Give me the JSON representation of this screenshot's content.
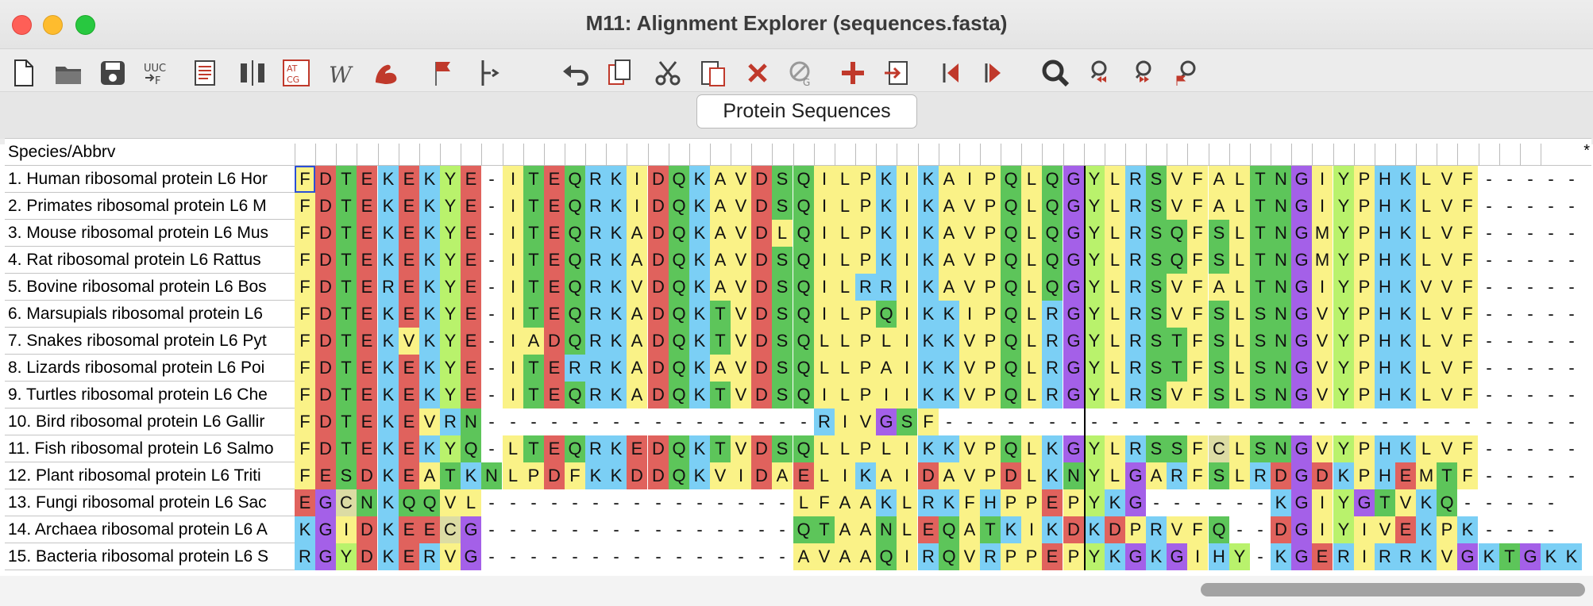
{
  "window": {
    "title": "M11: Alignment Explorer (sequences.fasta)"
  },
  "toolbar": {
    "icons": [
      "new-file-icon",
      "open-folder-icon",
      "save-icon",
      "translate-icon",
      "document-icon",
      "column-icon",
      "nucleotide-icon",
      "wordpad-icon",
      "muscle-icon",
      "flag-icon",
      "branch-icon",
      "undo-icon",
      "copy-icon",
      "cut-icon",
      "paste-icon",
      "delete-icon",
      "delete-gap-icon",
      "add-icon",
      "import-icon",
      "move-left-icon",
      "move-right-icon",
      "search-icon",
      "search-prev-icon",
      "search-next-icon",
      "search-flag-icon"
    ]
  },
  "tab": {
    "label": "Protein Sequences"
  },
  "table": {
    "header": "Species/Abbrv",
    "star": "*",
    "rows": [
      {
        "name": "1. Human ribosomal protein L6 Hor",
        "seq": "FDTEKEKYE-ITEQRKIDQKAVDSQILPKIKAIPQLQGYLRSVFALTNGIYPHKLVF-----"
      },
      {
        "name": "2. Primates ribosomal protein L6 M",
        "seq": "FDTEKEKYE-ITEQRKIDQKAVDSQILPKIKAVPQLQGYLRSVFALTNGIYPHKLVF-----"
      },
      {
        "name": "3. Mouse ribosomal protein L6 Mus",
        "seq": "FDTEKEKYE-ITEQRKADQKAVDLQILPKIKAVPQLQGYLRSQFSLTNGMYPHKLVF-----"
      },
      {
        "name": "4. Rat ribosomal protein L6 Rattus",
        "seq": "FDTEKEKYE-ITEQRKADQKAVDSQILPKIKAVPQLQGYLRSQFSLTNGMYPHKLVF-----"
      },
      {
        "name": "5. Bovine ribosomal protein L6 Bos",
        "seq": "FDTEREKYE-ITEQRKVDQKAVDSQILRRIKAVPQLQGYLRSVFALTNGIYPHKVVF-----"
      },
      {
        "name": "6. Marsupials ribosomal protein L6",
        "seq": "FDTEKEKYE-ITEQRKADQKTVDSQILPQIKKIPQLRGYLRSVFSLSNGVYPHKLVF-----"
      },
      {
        "name": "7. Snakes ribosomal protein L6 Pyt",
        "seq": "FDTEKVKYE-IADQRKADQKTVDSQLLPLIKKVPQLRGYLRSTFSLSNGVYPHKLVF-----"
      },
      {
        "name": "8. Lizards ribosomal protein L6 Poi",
        "seq": "FDTEKEKYE-ITERRKADQKAVDSQLLPAIKKVPQLRGYLRSTFSLSNGVYPHKLVF-----"
      },
      {
        "name": "9. Turtles ribosomal protein L6 Che",
        "seq": "FDTEKEKYE-ITEQRKADQKTVDSQILPIIKKVPQLRGYLRSVFSLSNGVYPHKLVF-----"
      },
      {
        "name": "10. Bird ribosomal protein L6 Gallir",
        "seq": "FDTEKEVRN----------------RIVGSF-------------------------------"
      },
      {
        "name": "11. Fish ribosomal protein L6 Salmo",
        "seq": "FDTEKEKYQ-LTEQRKEDQKTVDSQLLPLIKKVPQLKGYLRSSFCLSNGVYPHKLVF-----"
      },
      {
        "name": "12. Plant ribosomal protein L6 Triti",
        "seq": "FESDKEATKNLPDFKKDDQKVIDAELIKAIDAVPDLKNYLGARFSLRDGDKPHEMTF-----"
      },
      {
        "name": "13. Fungi ribosomal protein L6 Sac",
        "seq": "EGCNKQQVL---------------LFAAKLRKFHPPEPYKG------KGIYGTVKQ-----"
      },
      {
        "name": "14. Archaea ribosomal protein L6 A",
        "seq": "KGIDKEECG---------------QTAANLEQATKIKDKDPRVFQ--DGIYIVEKPK----"
      },
      {
        "name": "15. Bacteria ribosomal protein L6 S",
        "seq": "RGYDKERVG---------------AVAAQIRQVRPPEPYKGKGIHY-KGERIRRKVGKTGKK"
      }
    ]
  },
  "colors": {
    "A": "#faf287",
    "V": "#faf287",
    "L": "#faf287",
    "I": "#faf287",
    "F": "#faf287",
    "M": "#faf287",
    "P": "#faf287",
    "D": "#e0625d",
    "E": "#e0625d",
    "K": "#7bcff5",
    "R": "#7bcff5",
    "H": "#7bcff5",
    "Q": "#5dc55a",
    "N": "#5dc55a",
    "T": "#5dc55a",
    "S": "#5dc55a",
    "G": "#a460e8",
    "Y": "#b9f26c",
    "C": "#dcdca4",
    "W": "#dcdca4",
    "-": "#ffffff"
  }
}
